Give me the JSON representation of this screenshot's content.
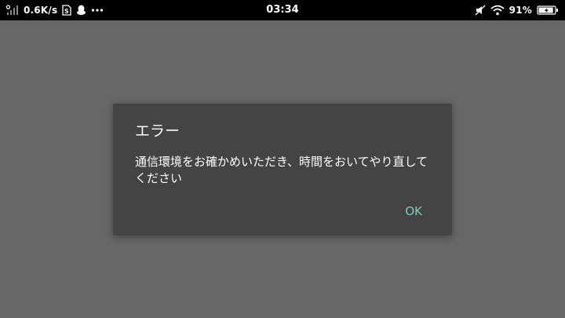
{
  "status_bar": {
    "net_speed": "0.6K/s",
    "time": "03:34",
    "battery_percent": "91%",
    "battery_level": 0.91,
    "icons": [
      "signal-icon",
      "sim-card-icon",
      "qq-penguin-icon",
      "more-dots-icon",
      "mute-icon",
      "wifi-icon",
      "battery-charging-icon"
    ]
  },
  "dialog": {
    "title": "エラー",
    "message": "通信環境をお確かめいただき、時間をおいてやり直してください",
    "ok_label": "OK"
  },
  "colors": {
    "backdrop": "#676767",
    "dialog_bg": "#444444",
    "accent": "#7fc9bd",
    "status_bar": "#000000"
  }
}
